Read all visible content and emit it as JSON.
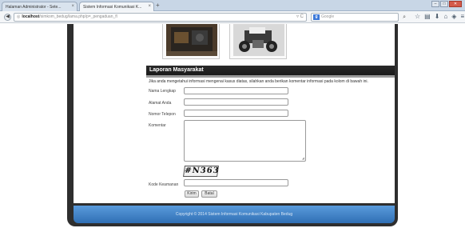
{
  "browser": {
    "tabs": [
      {
        "label": "Halaman Administrator - Sete...",
        "active": false
      },
      {
        "label": "Sistem Informasi Komunikasi K...",
        "active": true
      }
    ],
    "new_tab": "+",
    "window_controls": [
      "–",
      "□",
      "✕"
    ],
    "back_icon": "arrow-left-icon",
    "url_host": "localhost",
    "url_path": "/simkom_bedug/lama.php/p=_pengaduan_fl",
    "search_engine": "g",
    "search_placeholder": "Google",
    "toolbar_icons": [
      "search-icon",
      "star-icon",
      "clipboard-icon",
      "download-icon",
      "home-icon",
      "shield-icon",
      "menu-icon"
    ]
  },
  "section": {
    "title": "Laporan Masyarakat",
    "intro": "Jika anda mengetahui informasi mengenai kasus diatas, silahkan anda berikan komentar informasi pada kolom di bawah ini."
  },
  "form": {
    "nama_label": "Nama Lengkap",
    "alamat_label": "Alamat Anda",
    "telepon_label": "Nomor Telepon",
    "komentar_label": "Komentar",
    "captcha_text": "#N363",
    "kode_label": "Kode Keamanan",
    "kirim_label": "Kirim",
    "batal_label": "Batal"
  },
  "footer": {
    "text": "Copyright © 2014 Sistem Informasi Komunikasi Kabupaten Bedug"
  },
  "colors": {
    "container": "#2e2e2e",
    "section_header": "#1a1a1a",
    "footer": "#3f7fc4",
    "tabbar": "#c8d6e6"
  }
}
